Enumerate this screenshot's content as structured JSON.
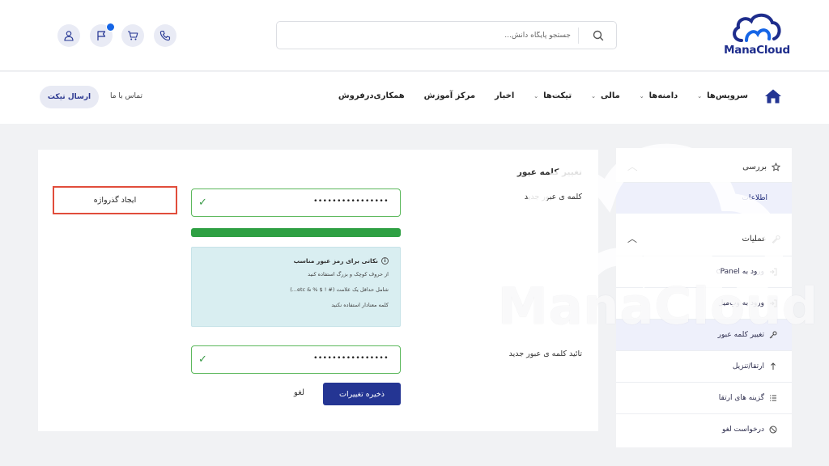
{
  "brand": {
    "logo_text": "ManaCloud",
    "colors": {
      "primary": "#243593",
      "accent": "#1565e6",
      "success": "#2ea043",
      "highlight": "#e14d3b"
    }
  },
  "header": {
    "search_placeholder": "جستجو پایگاه دانش...",
    "icons": [
      "search-icon",
      "phone-icon",
      "cart-icon",
      "flag-icon",
      "user-icon"
    ]
  },
  "nav": {
    "items": [
      {
        "label": "سرویس‌ها",
        "dropdown": true
      },
      {
        "label": "دامنه‌ها",
        "dropdown": true
      },
      {
        "label": "مالی",
        "dropdown": true
      },
      {
        "label": "تیکت‌ها",
        "dropdown": true
      },
      {
        "label": "اخبار",
        "dropdown": false
      },
      {
        "label": "مرکز آموزش",
        "dropdown": false
      },
      {
        "label": "همکاری‌درفروش",
        "dropdown": false
      }
    ],
    "contact_label": "تماس با ما",
    "ticket_button": "ارسال تیکت"
  },
  "sidebar": {
    "overview_title": "بررسی",
    "info_label": "اطلاعات",
    "actions_title": "عملیات",
    "items": [
      {
        "label": "ورود به cPanel",
        "icon": "login-icon"
      },
      {
        "label": "ورود به وب‌میل",
        "icon": "login-icon"
      },
      {
        "label": "تغییر کلمه عبور",
        "icon": "key-icon"
      },
      {
        "label": "ارتقا/تنزیل",
        "icon": "upgrade-icon"
      },
      {
        "label": "گزینه های ارتقا",
        "icon": "list-icon"
      },
      {
        "label": "درخواست لغو",
        "icon": "ban-icon"
      }
    ]
  },
  "form": {
    "title": "تغییر کلمه عبور",
    "new_password_label": "کلمه ی عبور جدید",
    "new_password_value": "••••••••••••••••",
    "strength_percent": 100,
    "tips_title": "نکاتی برای رمز عبور مناسب",
    "tips": [
      "از حروف کوچک و بزرگ استفاده کنید",
      "شامل حداقل یک علامت (# ! $ % & etc...)",
      "کلمه معنادار استفاده نکنید"
    ],
    "confirm_label": "تائید کلمه ی عبور جدید",
    "confirm_value": "••••••••••••••••",
    "save_button": "ذخیره تغییرات",
    "cancel_button": "لغو",
    "generate_button": "ایجاد گذرواژه"
  },
  "watermark_text": "ManaCloud"
}
